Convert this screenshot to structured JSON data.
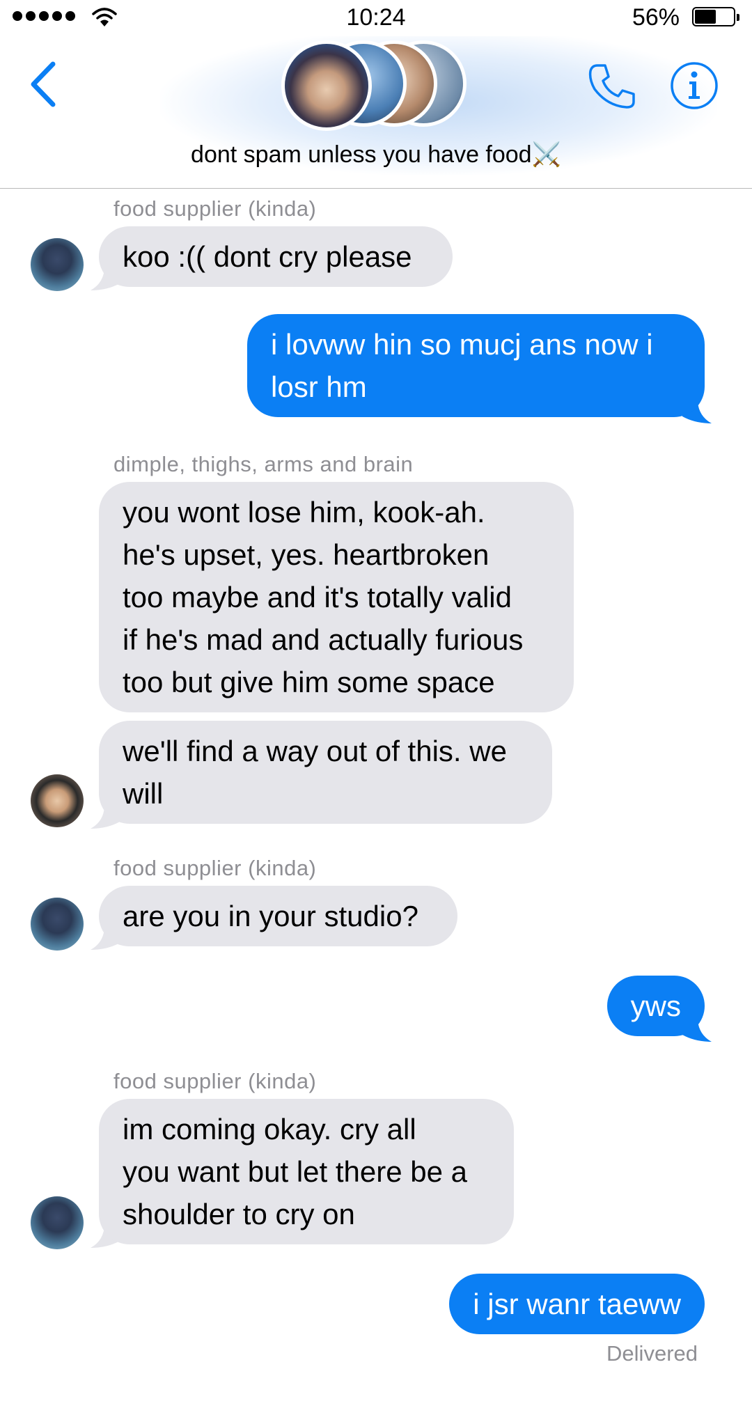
{
  "status_bar": {
    "time": "10:24",
    "battery_percent": "56%",
    "battery_level": 0.56
  },
  "header": {
    "group_title": "dont spam unless you have food⚔️",
    "back_icon": "chevron-left-icon",
    "call_icon": "phone-icon",
    "info_icon": "info-icon"
  },
  "colors": {
    "accent": "#0b7ff4",
    "incoming_bubble": "#e5e5ea",
    "sender_gray": "#8e8e93"
  },
  "thread": {
    "m1": {
      "sender": "food supplier (kinda)",
      "text": "koo :(( dont cry please"
    },
    "m2": {
      "text_l1": "i lovww hin so mucj ans now i",
      "text_l2": "losr hm"
    },
    "m3": {
      "sender": "dimple, thighs, arms and brain",
      "l1": "you wont lose him, kook-ah.",
      "l2": "he's upset, yes. heartbroken",
      "l3": "too maybe and it's totally valid",
      "l4": "if he's mad and actually furious",
      "l5": "too but give him some space"
    },
    "m4": {
      "l1": "we'll find a way out of this. we",
      "l2": "will"
    },
    "m5": {
      "sender": "food supplier (kinda)",
      "text": "are you in your studio?"
    },
    "m6": {
      "text": "yws"
    },
    "m7": {
      "sender": "food supplier (kinda)",
      "l1": "im coming okay. cry all",
      "l2": "you want but let there be a",
      "l3": "shoulder to cry on"
    },
    "m8": {
      "text": "i jsr wanr taeww"
    },
    "delivered": "Delivered"
  }
}
